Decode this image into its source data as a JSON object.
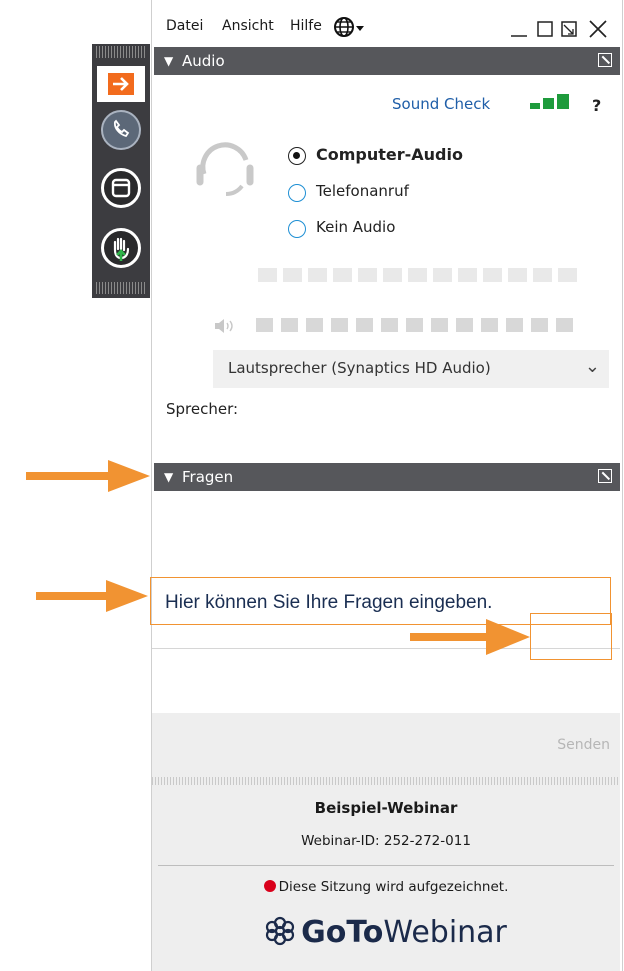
{
  "menu": {
    "items": [
      "Datei",
      "Ansicht",
      "Hilfe"
    ],
    "language_icon": "globe-icon",
    "window_controls": [
      "minimize-icon",
      "maximize-icon",
      "restore-icon",
      "close-icon"
    ]
  },
  "grabtab": {
    "buttons": [
      {
        "name": "show-hide-icon",
        "color": "#f26b1d"
      },
      {
        "name": "phone-icon",
        "color": "#5c6878"
      },
      {
        "name": "screen-icon",
        "color": "#2a2a2c"
      },
      {
        "name": "raise-hand-icon",
        "color": "#2a2a2c"
      }
    ]
  },
  "audio": {
    "header": "Audio",
    "sound_check": "Sound Check",
    "help": "?",
    "options": [
      "Computer-Audio",
      "Telefonanruf",
      "Kein Audio"
    ],
    "selected": "Computer-Audio",
    "speaker_device": "Lautsprecher (Synaptics HD Audio)",
    "speaker_label": "Sprecher:"
  },
  "questions": {
    "header": "Fragen",
    "input_hint": "Hier können Sie Ihre Fragen eingeben.",
    "send": "Senden"
  },
  "footer": {
    "title": "Beispiel-Webinar",
    "webinar_id": "Webinar-ID: 252-272-011",
    "recording": "Diese Sitzung wird aufgezeichnet.",
    "brand_bold": "GoTo",
    "brand_rest": "Webinar"
  },
  "colors": {
    "accent_orange": "#f19332",
    "header_bar": "#56575b",
    "link_blue": "#1f5ea8",
    "signal_green": "#1e9b3c",
    "record_red": "#d9001b"
  }
}
